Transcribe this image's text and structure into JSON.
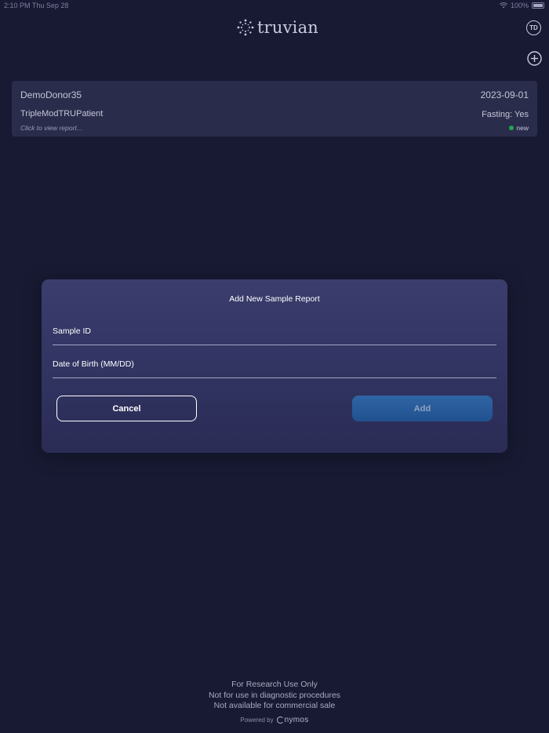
{
  "status_bar": {
    "time": "2:10 PM   Thu Sep 28",
    "battery": "100%"
  },
  "header": {
    "logo_text": "truvian",
    "profile_initials": "TD"
  },
  "report_card": {
    "donor": "DemoDonor35",
    "date": "2023-09-01",
    "patient": "TripleModTRUPatient",
    "fasting": "Fasting: Yes",
    "hint": "Click to view report...",
    "status": "new",
    "status_color": "#20a84a"
  },
  "modal": {
    "title": "Add New Sample Report",
    "sample_id_placeholder": "Sample ID",
    "dob_placeholder": "Date of Birth (MM/DD)",
    "cancel_label": "Cancel",
    "add_label": "Add"
  },
  "footer": {
    "line1": "For Research Use Only",
    "line2": "Not for use in diagnostic procedures",
    "line3": "Not available for commercial sale",
    "powered_by": "Powered by",
    "powered_brand": "nymos"
  },
  "colors": {
    "background": "#181a33",
    "card": "#2a2c4b",
    "accent": "#2f64a4"
  }
}
